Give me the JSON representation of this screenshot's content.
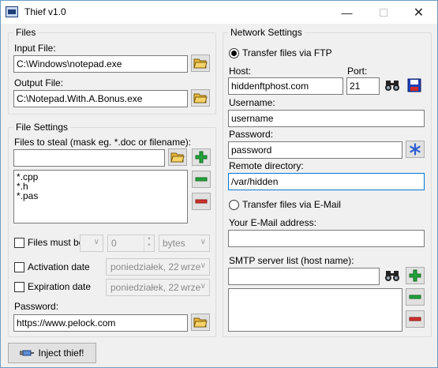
{
  "window": {
    "title": "Thief v1.0",
    "min_icon": "minimize-icon",
    "max_icon": "maximize-icon",
    "close_icon": "close-icon"
  },
  "files_group": {
    "title": "Files",
    "input_label": "Input File:",
    "input_value": "C:\\Windows\\notepad.exe",
    "output_label": "Output File:",
    "output_value": "C:\\Notepad.With.A.Bonus.exe"
  },
  "file_settings": {
    "title": "File Settings",
    "steal_label": "Files to steal (mask eg. *.doc or filename):",
    "steal_value": "",
    "masks": [
      "*.cpp",
      "*.h",
      "*.pas"
    ],
    "must_be_label": "Files must be",
    "must_be_op": "",
    "must_be_size": "0",
    "must_be_unit": "bytes",
    "activation_label": "Activation date",
    "activation_day": "poniedziałek, 22",
    "activation_month": "wrze",
    "expiration_label": "Expiration date",
    "expiration_day": "poniedziałek, 22",
    "expiration_month": "wrze",
    "password_label": "Password:",
    "password_value": "https://www.pelock.com"
  },
  "network": {
    "title": "Network Settings",
    "ftp_label": "Transfer files via FTP",
    "host_label": "Host:",
    "host_value": "hiddenftphost.com",
    "port_label": "Port:",
    "port_value": "21",
    "username_label": "Username:",
    "username_value": "username",
    "password_label": "Password:",
    "password_value": "password",
    "remote_dir_label": "Remote directory:",
    "remote_dir_value": "/var/hidden",
    "email_label": "Transfer files via E-Mail",
    "your_email_label": "Your E-Mail address:",
    "your_email_value": "",
    "smtp_label": "SMTP server list (host name):",
    "smtp_value": "",
    "smtp_servers": []
  },
  "inject_label": "Inject thief!",
  "colors": {
    "plus": "#22a33a",
    "minus_green": "#22a33a",
    "minus_red": "#d2322d",
    "save": "#1d3fb5",
    "asterisk": "#2c5fd3",
    "folder": "#e8b93a"
  }
}
